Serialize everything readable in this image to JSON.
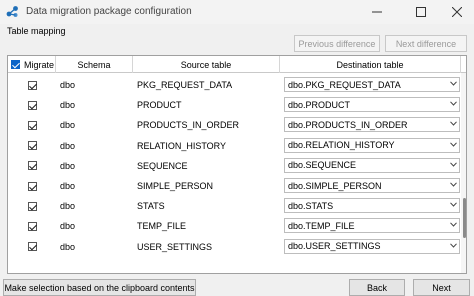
{
  "window": {
    "title": "Data migration package configuration"
  },
  "section_label": "Table mapping",
  "buttons": {
    "previous_difference": "Previous difference",
    "next_difference": "Next difference",
    "clipboard": "Make selection based on the clipboard contents",
    "back": "Back",
    "next": "Next"
  },
  "table": {
    "headers": {
      "migrate": "Migrate",
      "schema": "Schema",
      "source": "Source table",
      "destination": "Destination table"
    },
    "rows": [
      {
        "migrate": true,
        "schema": "dbo",
        "source": "PKG_REQUEST_DATA",
        "destination": "dbo.PKG_REQUEST_DATA"
      },
      {
        "migrate": true,
        "schema": "dbo",
        "source": "PRODUCT",
        "destination": "dbo.PRODUCT"
      },
      {
        "migrate": true,
        "schema": "dbo",
        "source": "PRODUCTS_IN_ORDER",
        "destination": "dbo.PRODUCTS_IN_ORDER"
      },
      {
        "migrate": true,
        "schema": "dbo",
        "source": "RELATION_HISTORY",
        "destination": "dbo.RELATION_HISTORY"
      },
      {
        "migrate": true,
        "schema": "dbo",
        "source": "SEQUENCE",
        "destination": "dbo.SEQUENCE"
      },
      {
        "migrate": true,
        "schema": "dbo",
        "source": "SIMPLE_PERSON",
        "destination": "dbo.SIMPLE_PERSON"
      },
      {
        "migrate": true,
        "schema": "dbo",
        "source": "STATS",
        "destination": "dbo.STATS"
      },
      {
        "migrate": true,
        "schema": "dbo",
        "source": "TEMP_FILE",
        "destination": "dbo.TEMP_FILE"
      },
      {
        "migrate": true,
        "schema": "dbo",
        "source": "USER_SETTINGS",
        "destination": "dbo.USER_SETTINGS"
      }
    ]
  },
  "icons": {
    "app": "app-logo-icon",
    "minimize": "minimize-icon",
    "maximize": "maximize-icon",
    "close": "close-icon",
    "dropdown": "chevron-down-icon"
  }
}
